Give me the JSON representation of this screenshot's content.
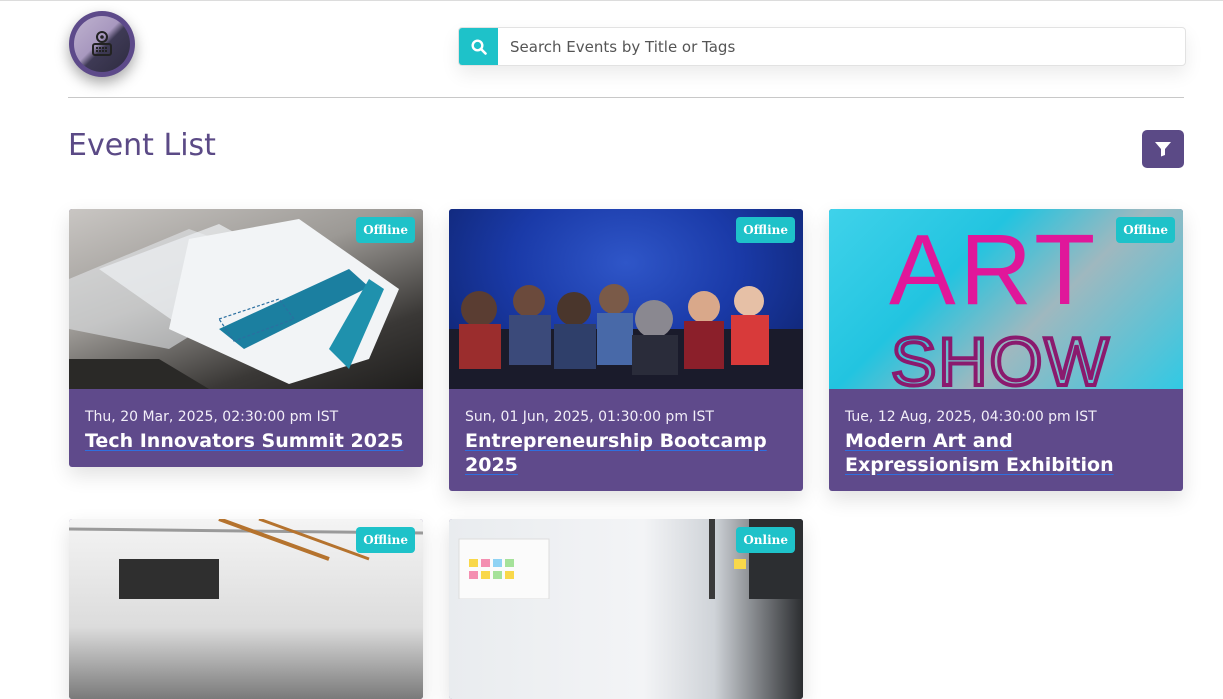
{
  "header": {
    "logo_icon": "event-projector-logo-icon",
    "search": {
      "placeholder": "Search Events by Title or Tags",
      "value": "",
      "icon": "search-icon"
    }
  },
  "page": {
    "title": "Event List",
    "filter_icon": "filter-icon"
  },
  "colors": {
    "primary": "#5b4a86",
    "accent": "#1ec2c9",
    "card_bg": "#5f4a8b"
  },
  "events": [
    {
      "badge": "Offline",
      "date": "Thu, 20 Mar, 2025, 02:30:00 pm IST",
      "title": "Tech Innovators Summit 2025"
    },
    {
      "badge": "Offline",
      "date": "Sun, 01 Jun, 2025, 01:30:00 pm IST",
      "title": "Entrepreneurship Bootcamp 2025"
    },
    {
      "badge": "Offline",
      "date": "Tue, 12 Aug, 2025, 04:30:00 pm IST",
      "title": "Modern Art and Expressionism Exhibition",
      "image_text_line1": "ART",
      "image_text_line2": "SHOW"
    },
    {
      "badge": "Offline"
    },
    {
      "badge": "Online"
    }
  ]
}
